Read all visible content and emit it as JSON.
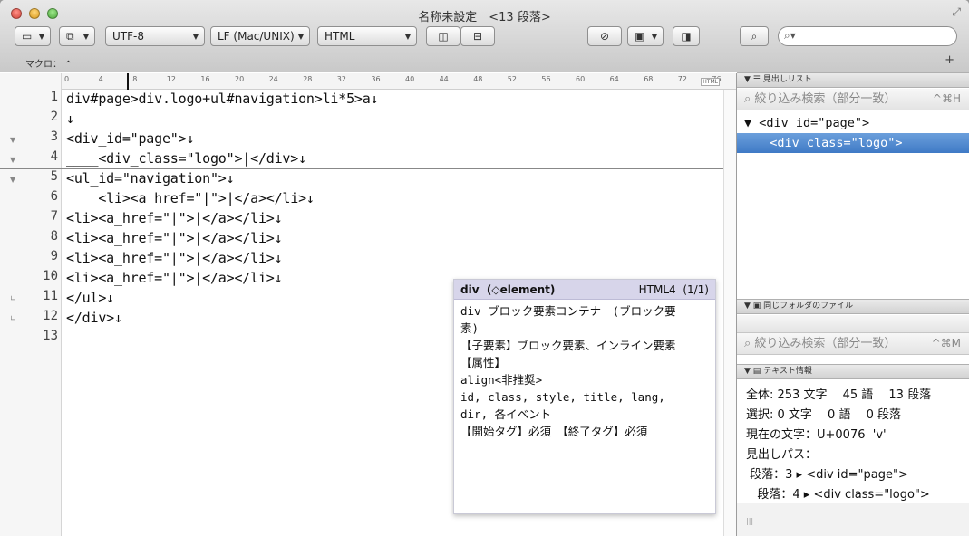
{
  "window": {
    "title": "名称未設定　<13 段落>"
  },
  "toolbar": {
    "encoding": "UTF-8",
    "line_ending": "LF (Mac/UNIX)",
    "syntax": "HTML",
    "search_placeholder": "",
    "macro_label": "マクロ：",
    "macro_arrow": "⌃",
    "add": "+"
  },
  "ruler": {
    "ticks": [
      "0",
      "4",
      "8",
      "12",
      "16",
      "20",
      "24",
      "28",
      "32",
      "36",
      "40",
      "44",
      "48",
      "52",
      "56",
      "60",
      "64",
      "68",
      "72",
      "76"
    ],
    "badge": "HTML"
  },
  "editor": {
    "line_numbers": [
      "1",
      "2",
      "3",
      "4",
      "5",
      "6",
      "7",
      "8",
      "9",
      "10",
      "11",
      "12",
      "13"
    ],
    "lines": [
      "div#page>div.logo+ul#navigation>li*5>a↓",
      "↓",
      "<div_id=\"page\">↓",
      "____<div_class=\"logo\">|</div>↓",
      "<ul_id=\"navigation\">↓",
      "____<li><a_href=\"|\">|</a></li>↓",
      "<li><a_href=\"|\">|</a></li>↓",
      "<li><a_href=\"|\">|</a></li>↓",
      "<li><a_href=\"|\">|</a></li>↓",
      "<li><a_href=\"|\">|</a></li>↓",
      "</ul>↓",
      "</div>↓",
      ""
    ]
  },
  "tooltip": {
    "element": "div",
    "type": "(◇element)",
    "version": "HTML4",
    "count": "(1/1)",
    "body": [
      "div ブロック要素コンテナ　(ブロック要",
      "素)",
      "【子要素】ブロック要素、インライン要素",
      "【属性】",
      "align<非推奨>",
      "id, class, style, title, lang,",
      "dir, 各イベント",
      "【開始タグ】必須　【終了タグ】必須"
    ]
  },
  "sidebar": {
    "outline_title": "見出しリスト",
    "filter_placeholder": "絞り込み検索（部分一致）",
    "filter_shortcut": "^⌘H",
    "outline_items": [
      "▼ <div id=\"page\">",
      "  <div class=\"logo\">"
    ],
    "folder_title": "同じフォルダのファイル",
    "filter2_placeholder": "絞り込み検索（部分一致）",
    "filter2_shortcut": "^⌘M",
    "info_title": "テキスト情報",
    "info_lines": [
      "全体: 253 文字　 45 語　 13 段落",
      "選択: 0 文字　 0 語　 0 段落",
      "現在の文字：U+0076  'v'",
      "見出しパス：",
      " 段落：3 ▸ <div id=\"page\">",
      "   段落：4 ▸ <div class=\"logo\">"
    ]
  },
  "colors": {
    "accent": "#3f7ac6",
    "tag": "#1c3fa8",
    "highlight": "#fff7a8",
    "tooltip_header": "#d7d5ea"
  }
}
